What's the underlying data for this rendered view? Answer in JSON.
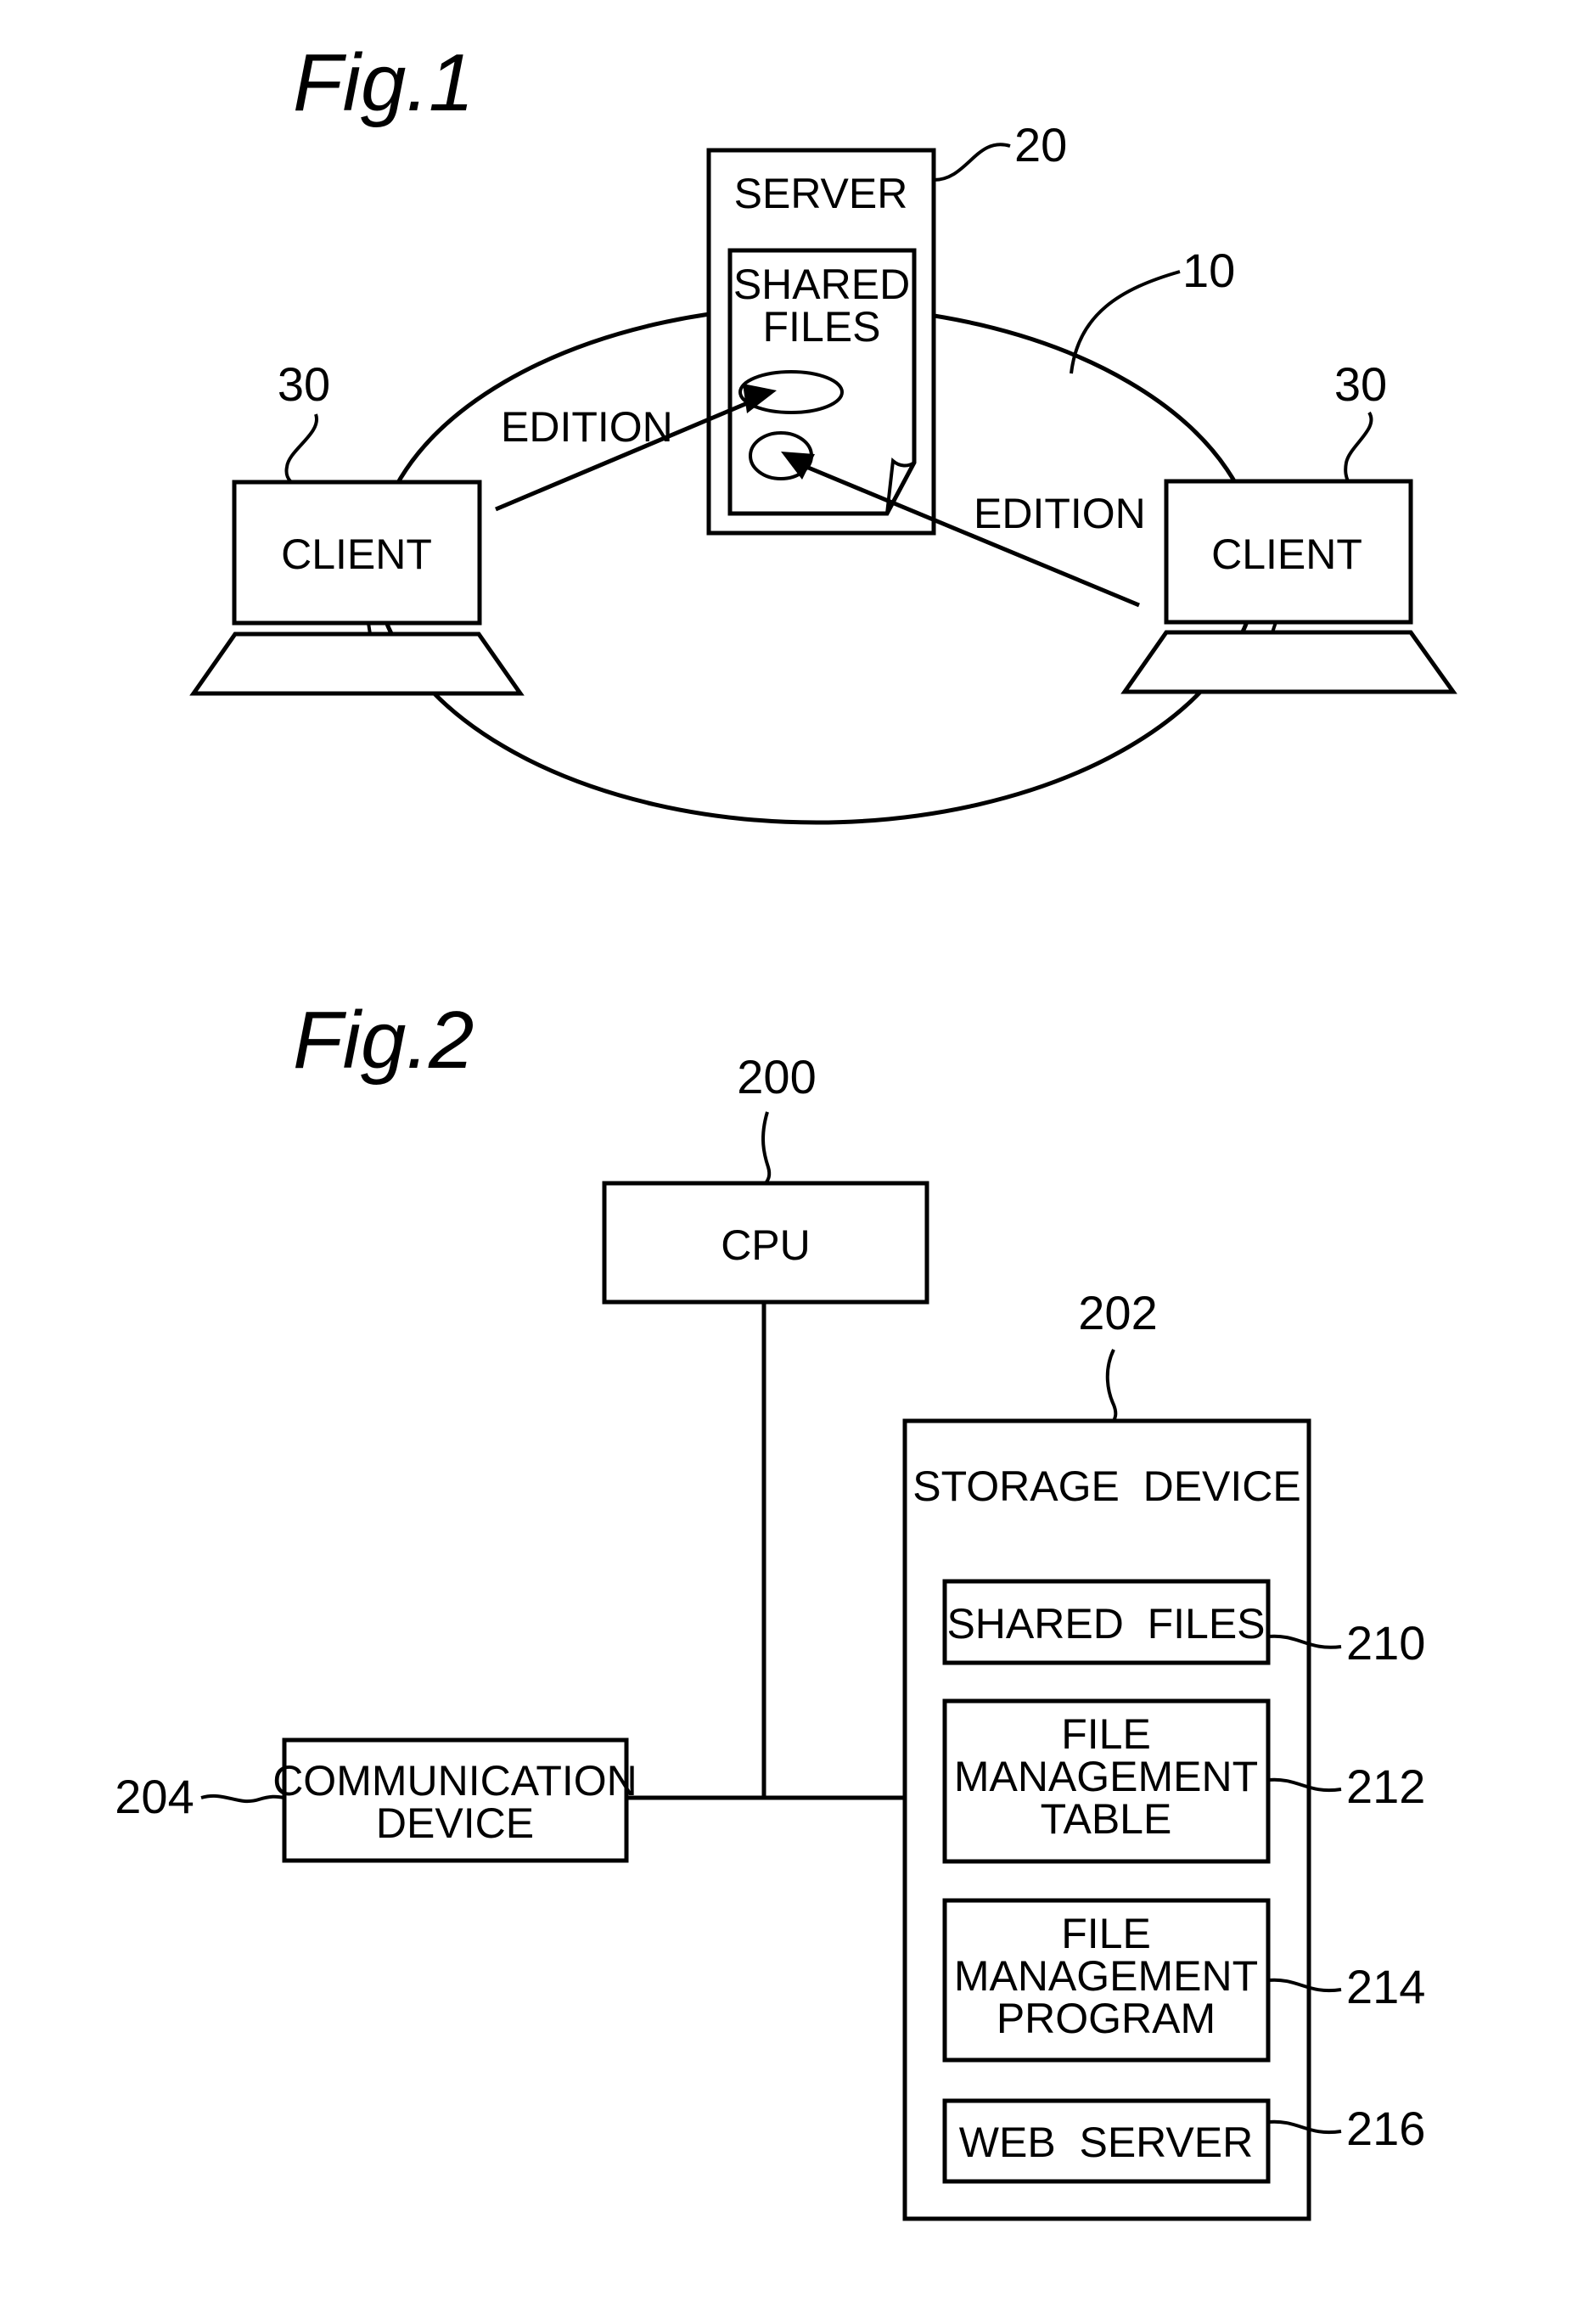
{
  "fig1": {
    "title": "Fig.1",
    "network_ref": "10",
    "server": {
      "label": "SERVER",
      "ref": "20",
      "files_label_line1": "SHARED",
      "files_label_line2": "FILES"
    },
    "clients": [
      {
        "label": "CLIENT",
        "ref": "30"
      },
      {
        "label": "CLIENT",
        "ref": "30"
      }
    ],
    "edition_labels": [
      "EDITION",
      "EDITION"
    ]
  },
  "fig2": {
    "title": "Fig.2",
    "cpu": {
      "label": "CPU",
      "ref": "200"
    },
    "comm": {
      "label_line1": "COMMUNICATION",
      "label_line2": "DEVICE",
      "ref": "204"
    },
    "storage": {
      "label": "STORAGE  DEVICE",
      "ref": "202",
      "items": [
        {
          "lines": [
            "SHARED  FILES"
          ],
          "ref": "210"
        },
        {
          "lines": [
            "FILE",
            "MANAGEMENT",
            "TABLE"
          ],
          "ref": "212"
        },
        {
          "lines": [
            "FILE",
            "MANAGEMENT",
            "PROGRAM"
          ],
          "ref": "214"
        },
        {
          "lines": [
            "WEB  SERVER"
          ],
          "ref": "216"
        }
      ]
    }
  }
}
